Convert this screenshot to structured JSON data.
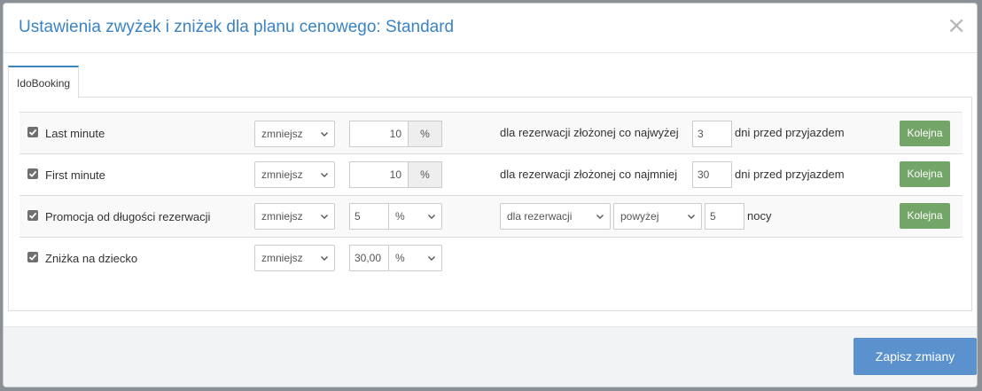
{
  "modal": {
    "title": "Ustawienia zwyżek i zniżek dla planu cenowego: Standard",
    "close_glyph": "×",
    "tab_label": "IdoBooking",
    "save_label": "Zapisz zmiany"
  },
  "rules": [
    {
      "checked": true,
      "label": "Last minute",
      "mode": "zmniejsz",
      "value": "10",
      "unit": "%",
      "condition_text": "dla rezerwacji złożonej co najwyżej",
      "days": "3",
      "days_suffix": "dni przed przyjazdem",
      "next_label": "Kolejna"
    },
    {
      "checked": true,
      "label": "First minute",
      "mode": "zmniejsz",
      "value": "10",
      "unit": "%",
      "condition_text": "dla rezerwacji złożonej co najmniej",
      "days": "30",
      "days_suffix": "dni przed przyjazdem",
      "next_label": "Kolejna"
    },
    {
      "checked": true,
      "label": "Promocja od długości rezerwacji",
      "mode": "zmniejsz",
      "value": "5",
      "unit": "%",
      "scope_select": "dla rezerwacji",
      "compare_select": "powyżej",
      "nights": "5",
      "nights_suffix": "nocy",
      "next_label": "Kolejna"
    },
    {
      "checked": true,
      "label": "Zniżka na dziecko",
      "mode": "zmniejsz",
      "value": "30,00",
      "unit": "%"
    }
  ],
  "icons": {
    "check": "check-icon",
    "caret": "chevron-down-icon",
    "close": "close-icon"
  },
  "colors": {
    "title": "#3a83c4",
    "next_button": "#74a568",
    "save_button": "#5b91cd"
  }
}
